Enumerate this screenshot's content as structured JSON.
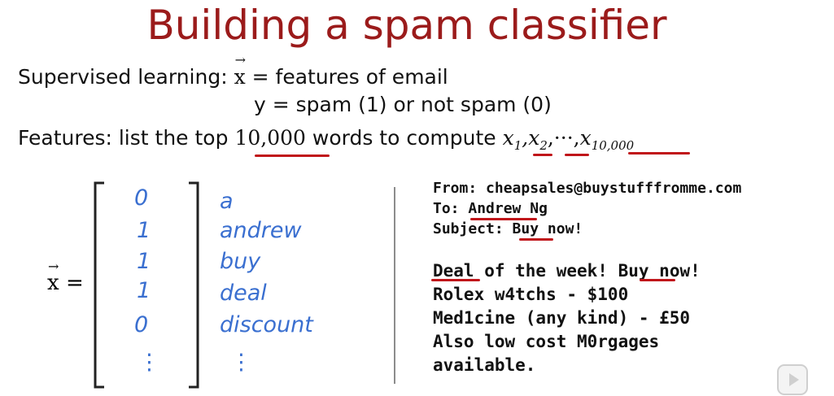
{
  "title": "Building a spam classifier",
  "supervised": {
    "label": "Supervised learning:",
    "x_symbol": "x",
    "x_def": "= features of email",
    "y_def": "y = spam (1) or not spam (0)"
  },
  "features": {
    "prefix": "Features: list the top",
    "count": "10,000",
    "middle": "words to compute",
    "x1": "x",
    "x1_sub": "1",
    "x2": "x",
    "x2_sub": "2",
    "dots": ",···,",
    "xn": "x",
    "xn_sub": "10,000"
  },
  "vector": {
    "label_symbol": "x",
    "label_equals": "=",
    "values": [
      "0",
      "1",
      "1",
      "1",
      "0",
      "⋮"
    ],
    "words": [
      "a",
      "andrew",
      "buy",
      "deal",
      "discount",
      "⋮"
    ]
  },
  "email": {
    "from": "From: cheapsales@buystufffromme.com",
    "to_prefix": "To: ",
    "to_name": "Andrew",
    "to_suffix": " Ng",
    "subject_prefix": "Subject: ",
    "subject_word": "Buy",
    "subject_suffix": " now!",
    "body_deal": "Deal",
    "body_mid": " of the week! ",
    "body_buy": "Buy",
    "body_end": " now!",
    "line2": "Rolex w4tchs - $100",
    "line3": "Med1cine (any kind) - £50",
    "line4": "Also low cost M0rgages",
    "line5": "available."
  },
  "colors": {
    "title": "#9b1b1b",
    "underline": "#c0151a",
    "handwriting": "#3a6fd0"
  },
  "icons": [
    "play-button-icon"
  ]
}
